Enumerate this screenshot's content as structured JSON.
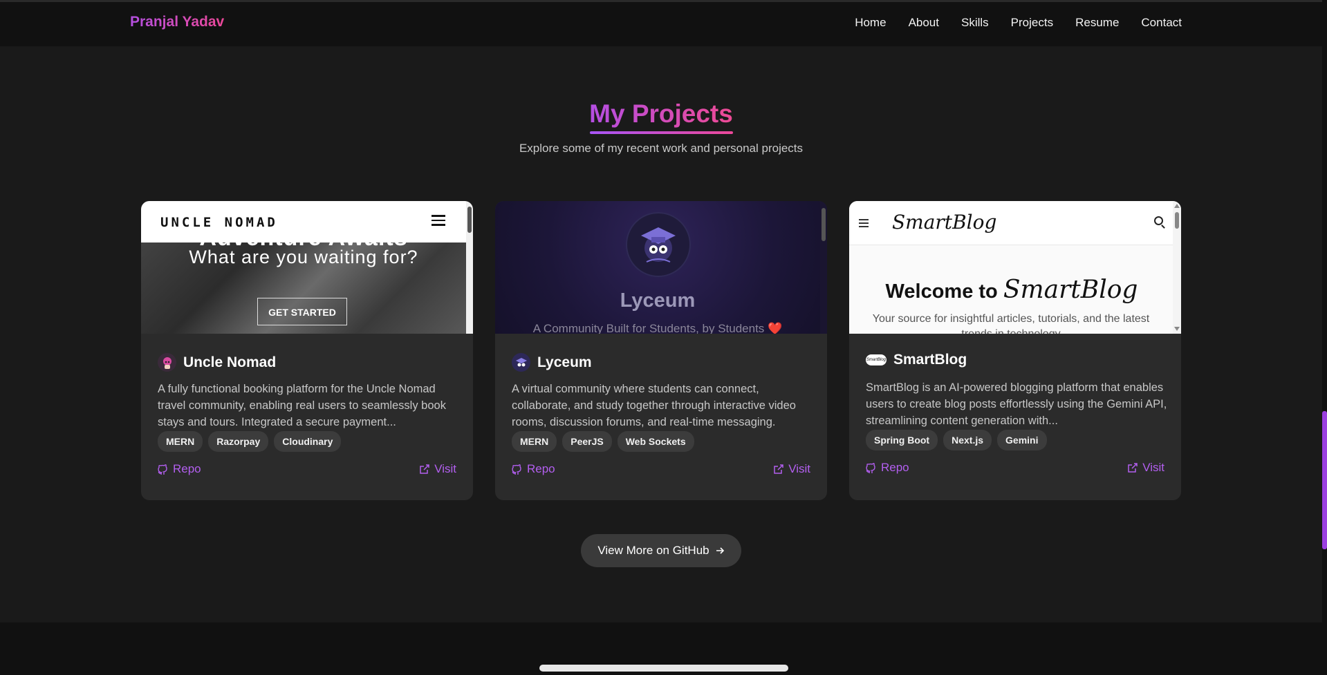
{
  "navbar": {
    "brand": "Pranjal Yadav",
    "links": [
      "Home",
      "About",
      "Skills",
      "Projects",
      "Resume",
      "Contact"
    ]
  },
  "section": {
    "title": "My Projects",
    "subtitle": "Explore some of my recent work and personal projects"
  },
  "projects": [
    {
      "name": "Uncle Nomad",
      "preview": {
        "logo": "UNCLE NOMAD",
        "hero_partial": "Adventure Awaits",
        "hero_sub": "What are you waiting for?",
        "cta": "GET STARTED"
      },
      "description": "A fully functional booking platform for the Uncle Nomad travel community, enabling real users to seamlessly book stays and tours. Integrated a secure payment...",
      "tags": [
        "MERN",
        "Razorpay",
        "Cloudinary"
      ],
      "repo_label": "Repo",
      "visit_label": "Visit"
    },
    {
      "name": "Lyceum",
      "preview": {
        "title": "Lyceum",
        "subtitle": "A Community Built for Students, by Students ❤️"
      },
      "description": "A virtual community where students can connect, collaborate, and study together through interactive video rooms, discussion forums, and real-time messaging.",
      "tags": [
        "MERN",
        "PeerJS",
        "Web Sockets"
      ],
      "repo_label": "Repo",
      "visit_label": "Visit"
    },
    {
      "name": "SmartBlog",
      "preview": {
        "logo": "SmartBlog",
        "welcome_prefix": "Welcome to",
        "welcome_script": "SmartBlog",
        "desc": "Your source for insightful articles, tutorials, and the latest trends in technology"
      },
      "description": "SmartBlog is an AI-powered blogging platform that enables users to create blog posts effortlessly using the Gemini API, streamlining content generation with...",
      "tags": [
        "Spring Boot",
        "Next.js",
        "Gemini"
      ],
      "repo_label": "Repo",
      "visit_label": "Visit"
    }
  ],
  "github_button": "View More on GitHub",
  "colors": {
    "accent": "#b35ff0",
    "gradient_start": "#b44ee3",
    "gradient_end": "#ee4a94",
    "bg": "#1a1a1a",
    "card": "#2b2b2b"
  }
}
